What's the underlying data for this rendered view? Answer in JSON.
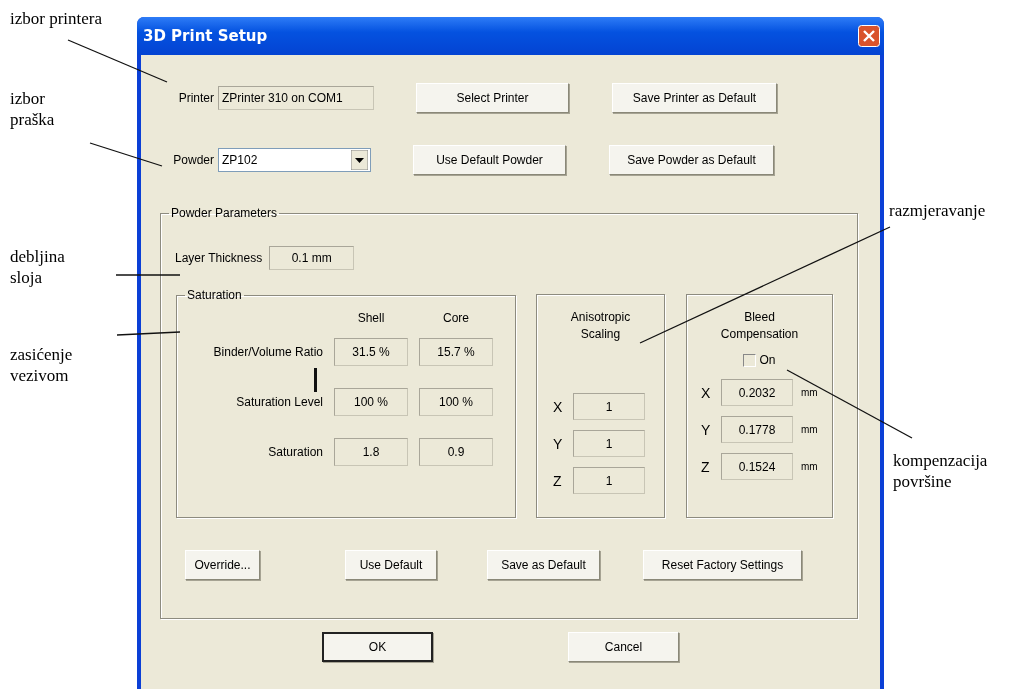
{
  "annotations": [
    {
      "text": "izbor printera"
    },
    {
      "text": "izbor praška"
    },
    {
      "text": "debljina sloja"
    },
    {
      "text": "zasićenje vezivom"
    },
    {
      "text": "razmjeravanje"
    },
    {
      "text": "kompenzacija površine"
    }
  ],
  "window": {
    "title": "3D Print Setup"
  },
  "printer": {
    "label": "Printer",
    "value": "ZPrinter 310 on COM1",
    "buttons": [
      "Select Printer",
      "Save Printer as Default"
    ]
  },
  "powder": {
    "label": "Powder",
    "value": "ZP102",
    "buttons": [
      "Use Default Powder",
      "Save Powder as Default"
    ]
  },
  "powder_parameters": {
    "title": "Powder Parameters",
    "layer_thickness": {
      "label": "Layer Thickness",
      "value": "0.1 mm"
    },
    "saturation": {
      "title": "Saturation",
      "columns": [
        "Shell",
        "Core"
      ],
      "rows": [
        {
          "label": "Binder/Volume Ratio",
          "values": [
            "31.5 %",
            "15.7 %"
          ]
        },
        {
          "label": "Saturation Level",
          "values": [
            "100 %",
            "100 %"
          ]
        },
        {
          "label": "Saturation",
          "values": [
            "1.8",
            "0.9"
          ]
        }
      ]
    },
    "anisotropic_scaling": {
      "title": "Anisotropic Scaling",
      "axes": [
        {
          "axis": "X",
          "value": "1"
        },
        {
          "axis": "Y",
          "value": "1"
        },
        {
          "axis": "Z",
          "value": "1"
        }
      ]
    },
    "bleed_compensation": {
      "title": "Bleed Compensation",
      "checkbox": {
        "label": "On",
        "checked": false
      },
      "axes": [
        {
          "axis": "X",
          "value": "0.2032",
          "unit": "mm"
        },
        {
          "axis": "Y",
          "value": "0.1778",
          "unit": "mm"
        },
        {
          "axis": "Z",
          "value": "0.1524",
          "unit": "mm"
        }
      ]
    },
    "buttons": [
      "Override...",
      "Use Default",
      "Save as Default",
      "Reset Factory Settings"
    ]
  },
  "dialog_buttons": [
    {
      "label": "OK",
      "default": true
    },
    {
      "label": "Cancel",
      "default": false
    }
  ]
}
